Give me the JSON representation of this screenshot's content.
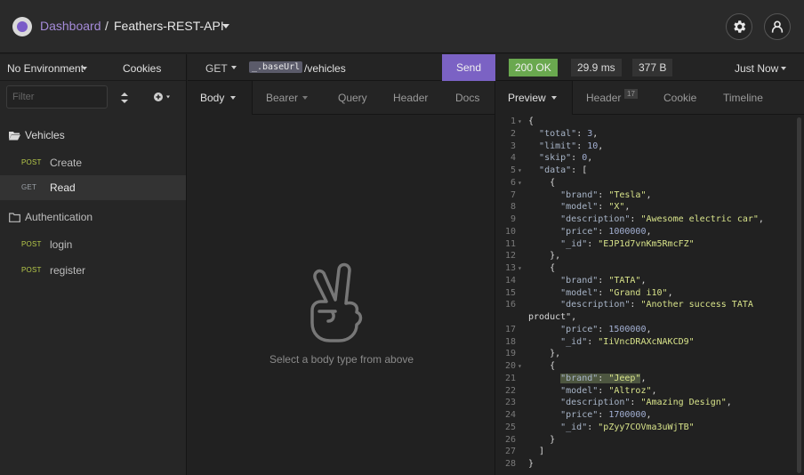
{
  "topbar": {
    "dashboard": "Dashboard",
    "separator": "/",
    "project": "Feathers-REST-API"
  },
  "sidebar": {
    "environment": "No Environment",
    "cookies": "Cookies",
    "filter_placeholder": "Filter",
    "folders": [
      {
        "name": "Vehicles",
        "requests": [
          {
            "method": "POST",
            "name": "Create"
          },
          {
            "method": "GET",
            "name": "Read"
          }
        ]
      },
      {
        "name": "Authentication",
        "requests": [
          {
            "method": "POST",
            "name": "login"
          },
          {
            "method": "POST",
            "name": "register"
          }
        ]
      }
    ]
  },
  "request": {
    "method": "GET",
    "base_url_tag": "_.baseUrl",
    "path": "/vehicles",
    "send": "Send",
    "tabs": {
      "body": "Body",
      "auth": "Bearer",
      "query": "Query",
      "header": "Header",
      "docs": "Docs"
    },
    "empty_message": "Select a body type from above"
  },
  "response": {
    "status": "200 OK",
    "time": "29.9 ms",
    "size": "377 B",
    "when": "Just Now",
    "tabs": {
      "preview": "Preview",
      "header": "Header",
      "header_count": "17",
      "cookie": "Cookie",
      "timeline": "Timeline"
    },
    "lines": [
      "{",
      "  \"total\": 3,",
      "  \"limit\": 10,",
      "  \"skip\": 0,",
      "  \"data\": [",
      "    {",
      "      \"brand\": \"Tesla\",",
      "      \"model\": \"X\",",
      "      \"description\": \"Awesome electric car\",",
      "      \"price\": 1000000,",
      "      \"_id\": \"EJP1d7vnKm5RmcFZ\"",
      "    },",
      "    {",
      "      \"brand\": \"TATA\",",
      "      \"model\": \"Grand i10\",",
      "      \"description\": \"Another success TATA",
      "product\",",
      "      \"price\": 1500000,",
      "      \"_id\": \"IiVncDRAXcNAKCD9\"",
      "    },",
      "    {",
      "      \"brand\": \"Jeep\",",
      "      \"model\": \"Altroz\",",
      "      \"description\": \"Amazing Design\",",
      "      \"price\": 1700000,",
      "      \"_id\": \"pZyy7COVma3uWjTB\"",
      "    }",
      "  ]",
      "}"
    ],
    "line_numbers": [
      "1",
      "2",
      "3",
      "4",
      "5",
      "6",
      "7",
      "8",
      "9",
      "10",
      "11",
      "12",
      "13",
      "14",
      "15",
      "16",
      "",
      "17",
      "18",
      "19",
      "20",
      "21",
      "22",
      "23",
      "24",
      "25",
      "26",
      "27",
      "28"
    ]
  },
  "colors": {
    "accent": "#7b62c4",
    "ok": "#6aa84f",
    "post": "#b6c94a"
  }
}
